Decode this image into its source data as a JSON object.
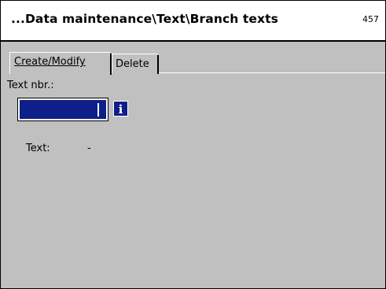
{
  "header": {
    "title": "...Data maintenance\\Text\\Branch texts",
    "screen_number": "457"
  },
  "tabs": [
    {
      "label": "Create/Modify",
      "active": true
    },
    {
      "label": "Delete",
      "active": false
    }
  ],
  "form": {
    "text_nbr_label": "Text nbr.:",
    "text_nbr_value": "",
    "info_button_glyph": "i",
    "text_label": "Text:",
    "text_value": "-"
  },
  "colors": {
    "content_background": "#c0c0c0",
    "input_background": "#0f1f8a",
    "title_background": "#ffffff"
  },
  "icons": {
    "info": "info-icon"
  }
}
